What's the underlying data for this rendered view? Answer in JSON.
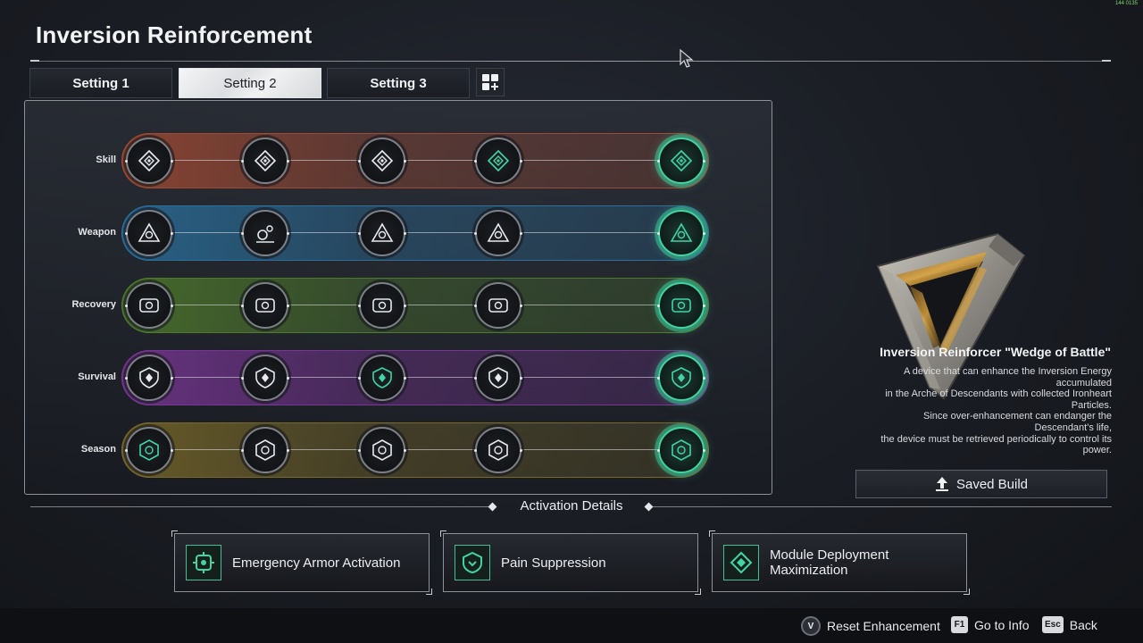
{
  "header": {
    "title": "Inversion Reinforcement",
    "fps_readout": "144 0135"
  },
  "tabs": [
    {
      "label": "Setting 1",
      "active": false
    },
    {
      "label": "Setting 2",
      "active": true
    },
    {
      "label": "Setting 3",
      "active": false
    }
  ],
  "tab_add_icon": "add-grid-icon",
  "rows": [
    {
      "label": "Skill",
      "color": "#a04a33",
      "icons": [
        "skill-diamond-icon",
        "skill-diamond-icon",
        "skill-diamond-icon",
        "skill-diamond-icon",
        "skill-diamond-icon"
      ]
    },
    {
      "label": "Weapon",
      "color": "#2b6f9c",
      "icons": [
        "weapon-triangle-icon",
        "weapon-gear-icon",
        "weapon-triangle-icon",
        "weapon-triangle-icon",
        "weapon-triangle-icon"
      ]
    },
    {
      "label": "Recovery",
      "color": "#4f7a2c",
      "icons": [
        "recovery-card-icon",
        "recovery-card-icon",
        "recovery-card-icon",
        "recovery-card-icon",
        "recovery-card-icon"
      ]
    },
    {
      "label": "Survival",
      "color": "#7a3696",
      "icons": [
        "survival-shield-icon",
        "survival-shield-icon",
        "survival-shield-icon",
        "survival-shield-icon",
        "survival-shield-icon"
      ]
    },
    {
      "label": "Season",
      "color": "#7a6a2a",
      "icons": [
        "season-hex-icon",
        "season-hex-icon",
        "season-hex-icon",
        "season-hex-icon",
        "season-hex-icon"
      ]
    }
  ],
  "accent": "#3fd6a3",
  "info": {
    "title": "Inversion Reinforcer \"Wedge of Battle\"",
    "desc_lines": [
      "A device that can enhance the Inversion Energy",
      "accumulated",
      "in the Arche of Descendants with collected Ironheart",
      "Particles.",
      "Since over-enhancement can endanger the",
      "Descendant's life,",
      "the device must be retrieved periodically to control its",
      "power."
    ],
    "saved_build_label": "Saved Build"
  },
  "activation": {
    "title": "Activation Details",
    "cards": [
      {
        "label": "Emergency Armor Activation",
        "icon": "armor-activation-icon"
      },
      {
        "label": "Pain Suppression",
        "icon": "pain-suppression-icon"
      },
      {
        "label": "Module Deployment Maximization",
        "icon": "module-deployment-icon"
      }
    ]
  },
  "footer": {
    "hints": [
      {
        "key": "V",
        "label": "Reset Enhancement"
      },
      {
        "key": "F1",
        "label": "Go to Info"
      },
      {
        "key": "Esc",
        "label": "Back"
      }
    ]
  }
}
